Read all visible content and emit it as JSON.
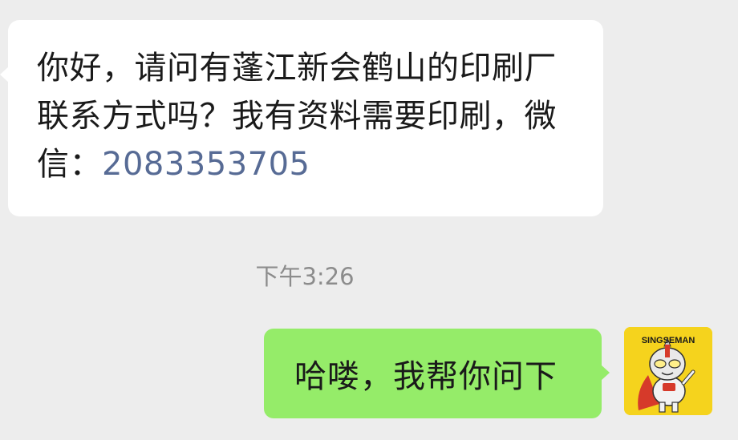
{
  "conversation": {
    "incoming_message": {
      "text": "你好，请问有蓬江新会鹤山的印刷厂联系方式吗？我有资料需要印刷，微信：",
      "wechat_id": "2083353705"
    },
    "timestamp": "下午3:26",
    "outgoing_message": {
      "text": "哈喽，我帮你问下"
    },
    "avatar": {
      "label": "SINGSEMAN",
      "icon": "cartoon-hero-avatar-icon"
    }
  },
  "colors": {
    "background": "#ededed",
    "incoming_bubble": "#ffffff",
    "outgoing_bubble": "#95ec69",
    "link": "#576b95",
    "timestamp": "#8c8c8c",
    "avatar_bg": "#f5d31d"
  }
}
